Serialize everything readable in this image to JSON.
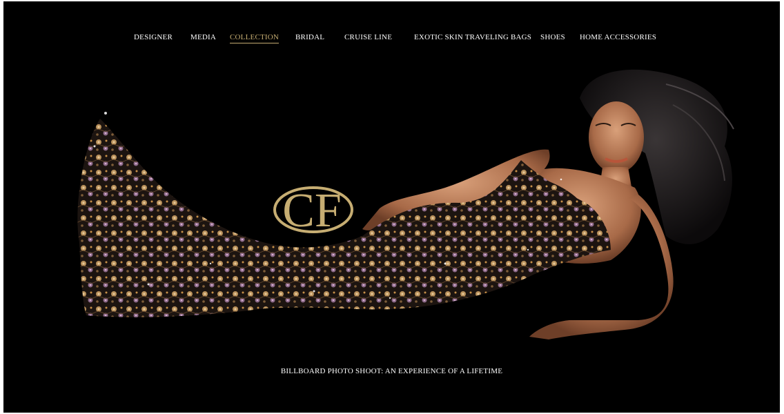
{
  "nav": {
    "items": [
      {
        "label": "DESIGNER"
      },
      {
        "label": "MEDIA"
      },
      {
        "label": "COLLECTION",
        "active": true
      },
      {
        "label": "BRIDAL"
      },
      {
        "label": "CRUISE LINE"
      },
      {
        "label": "EXOTIC SKIN TRAVELING BAGS"
      },
      {
        "label": "SHOES"
      },
      {
        "label": "HOME ACCESSORIES"
      }
    ]
  },
  "hero": {
    "logo_text": "CF",
    "caption": "BILLBOARD PHOTO SHOOT: AN EXPERIENCE OF A LIFETIME"
  },
  "colors": {
    "background": "#000000",
    "gold_accent": "#c6ad72",
    "text": "#ffffff"
  }
}
